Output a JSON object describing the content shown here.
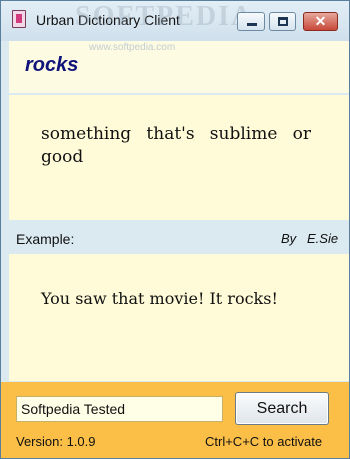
{
  "window": {
    "title": "Urban Dictionary Client",
    "watermark": "SOFTPEDIA",
    "watermark_url": "www.softpedia.com",
    "buttons": {
      "minimize_icon": "minimize-icon",
      "maximize_icon": "maximize-icon",
      "close_icon": "close-icon",
      "close_glyph": "✕"
    }
  },
  "entry": {
    "word": "rocks",
    "definition": "something that's sublime or good",
    "example_label": "Example:",
    "author_prefix": "By",
    "author": "E.Sie",
    "example": "You saw that movie! It rocks!"
  },
  "search": {
    "value": "Softpedia Tested",
    "button_label": "Search"
  },
  "status": {
    "version": "Version: 1.0.9",
    "shortcut": "Ctrl+C+C  to activate"
  },
  "colors": {
    "word": "#10137a",
    "panel_background": "#fffbd8",
    "window_background": "#dbe9f1",
    "bottom_bar": "#fbbf47"
  }
}
